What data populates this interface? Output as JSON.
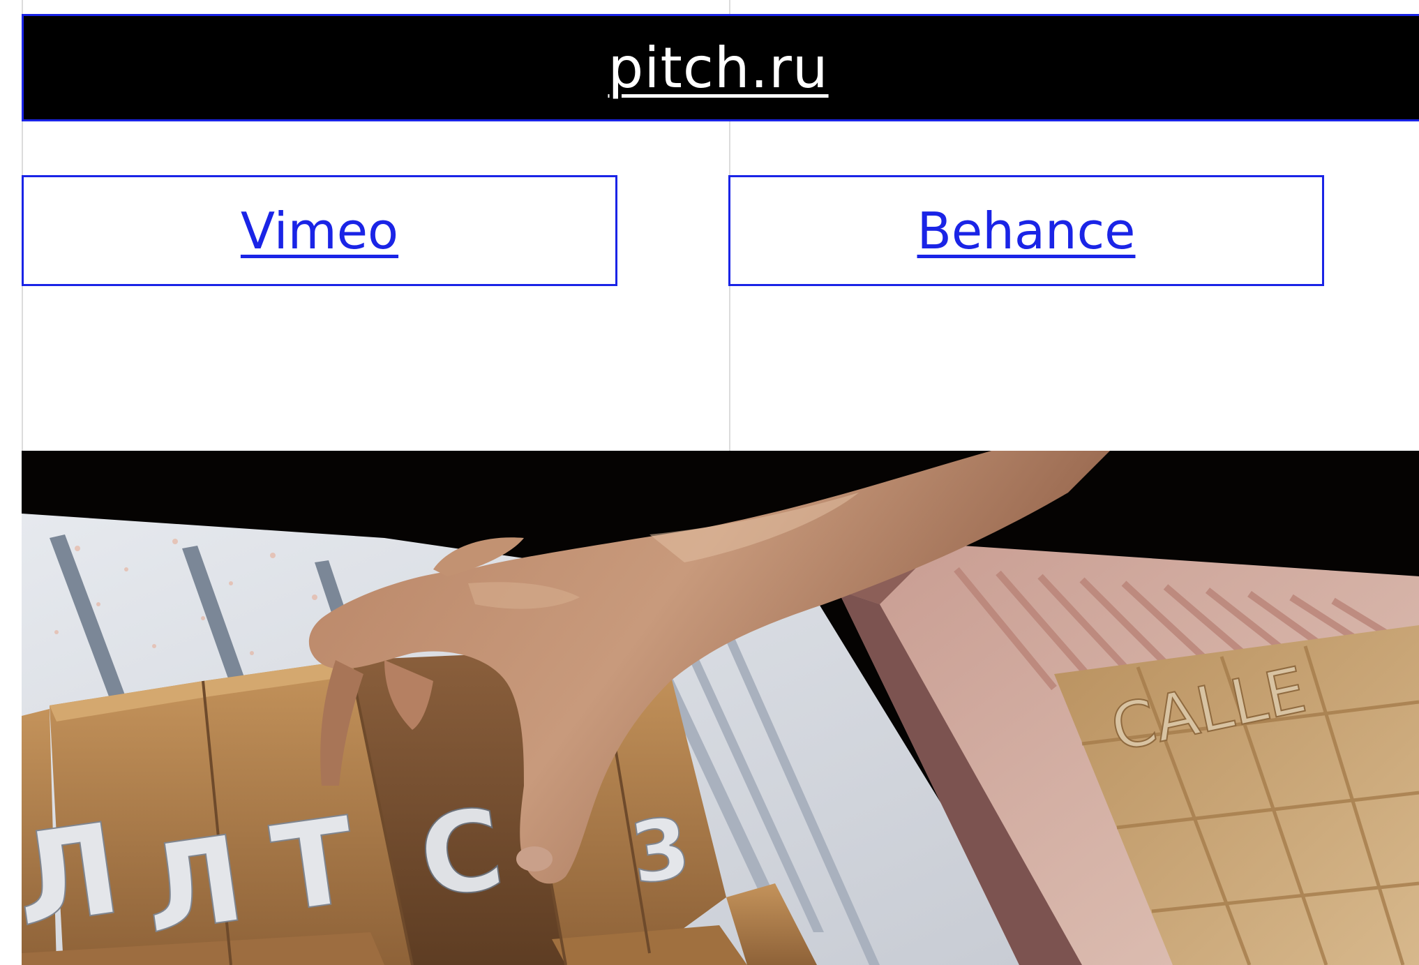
{
  "banner": {
    "title": "pitch.ru"
  },
  "links": {
    "vimeo": "Vimeo",
    "behance": "Behance"
  },
  "photo": {
    "left_tiles": [
      "Л",
      "Т",
      "С",
      "3"
    ],
    "right_text": "CALLE"
  },
  "colors": {
    "accent": "#1a24e6",
    "banner_bg": "#000000",
    "page_bg": "#ffffff"
  }
}
